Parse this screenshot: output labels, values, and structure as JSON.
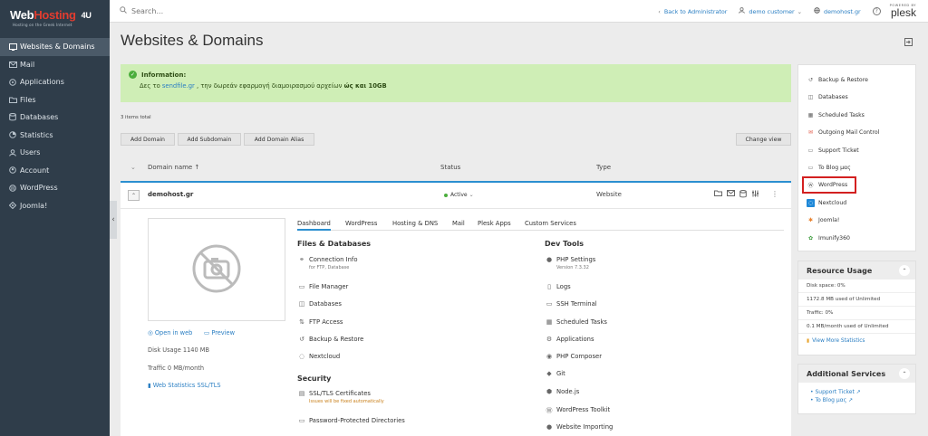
{
  "brand": {
    "name_part1": "Web",
    "name_part2": "Hosting",
    "name_part3": "4U",
    "tagline": "Hosting on the Greek Internet"
  },
  "sidebar": {
    "items": [
      {
        "label": "Websites & Domains",
        "icon": "globe-icon",
        "active": true
      },
      {
        "label": "Mail",
        "icon": "mail-icon"
      },
      {
        "label": "Applications",
        "icon": "applications-icon"
      },
      {
        "label": "Files",
        "icon": "folder-icon"
      },
      {
        "label": "Databases",
        "icon": "database-icon"
      },
      {
        "label": "Statistics",
        "icon": "statistics-icon"
      },
      {
        "label": "Users",
        "icon": "user-icon"
      },
      {
        "label": "Account",
        "icon": "account-icon"
      },
      {
        "label": "WordPress",
        "icon": "wordpress-icon"
      },
      {
        "label": "Joomla!",
        "icon": "joomla-icon"
      }
    ]
  },
  "topbar": {
    "search_placeholder": "Search...",
    "back_to_admin": "Back to Administrator",
    "customer": "demo customer",
    "domain": "demohost.gr",
    "powered_by": "POWERED BY",
    "plesk": "plesk"
  },
  "page": {
    "title": "Websites & Domains"
  },
  "info": {
    "title": "Information:",
    "msg_prefix": "Δες το ",
    "msg_link": "sendfile.gr",
    "msg_middle": " , την δωρεάν εφαρμογή διαμοιρασμού αρχείων ",
    "msg_bold": "ώς και 10GB"
  },
  "list": {
    "items_total": "3 items total",
    "buttons": {
      "add_domain": "Add Domain",
      "add_subdomain": "Add Subdomain",
      "add_alias": "Add Domain Alias",
      "change_view": "Change view"
    },
    "columns": {
      "domain": "Domain name ↑",
      "status": "Status",
      "type": "Type"
    }
  },
  "domain_row": {
    "name": "demohost.gr",
    "status": "Active",
    "type": "Website"
  },
  "domain_panel": {
    "open_in_web": "Open in web",
    "preview": "Preview",
    "disk_usage": "Disk Usage 1140 MB",
    "traffic": "Traffic 0 MB/month",
    "web_stats": "Web Statistics SSL/TLS",
    "tabs": [
      "Dashboard",
      "WordPress",
      "Hosting & DNS",
      "Mail",
      "Plesk Apps",
      "Custom Services"
    ],
    "files_title": "Files & Databases",
    "dev_title": "Dev Tools",
    "security_title": "Security",
    "tools": {
      "connection_info": "Connection Info",
      "connection_info_sub": "for FTP, Database",
      "file_manager": "File Manager",
      "databases": "Databases",
      "ftp_access": "FTP Access",
      "backup_restore": "Backup & Restore",
      "nextcloud": "Nextcloud",
      "ssl_tls": "SSL/TLS Certificates",
      "ssl_tls_sub": "Issues will be fixed automatically",
      "password_dirs": "Password-Protected Directories",
      "php_settings": "PHP Settings",
      "php_version": "Version 7.3.32",
      "logs": "Logs",
      "ssh_terminal": "SSH Terminal",
      "scheduled_tasks": "Scheduled Tasks",
      "applications": "Applications",
      "php_composer": "PHP Composer",
      "git": "Git",
      "nodejs": "Node.js",
      "wp_toolkit": "WordPress Toolkit",
      "website_importing": "Website Importing"
    }
  },
  "right_column": {
    "links": [
      {
        "label": "Backup & Restore",
        "icon": "backup-icon"
      },
      {
        "label": "Databases",
        "icon": "database-icon"
      },
      {
        "label": "Scheduled Tasks",
        "icon": "calendar-icon"
      },
      {
        "label": "Outgoing Mail Control",
        "icon": "mail-control-icon"
      },
      {
        "label": "Support Ticket",
        "icon": "ticket-icon"
      },
      {
        "label": "To Blog μας",
        "icon": "blog-icon"
      },
      {
        "label": "WordPress",
        "icon": "wordpress-icon"
      },
      {
        "label": "Nextcloud",
        "icon": "nextcloud-icon"
      },
      {
        "label": "Joomla!",
        "icon": "joomla-icon"
      },
      {
        "label": "Imunify360",
        "icon": "imunify-icon"
      }
    ],
    "resource_usage": {
      "title": "Resource Usage",
      "disk_label": "Disk space: 0%",
      "disk_value": "1172.8 MB used of Unlimited",
      "traffic_label": "Traffic: 0%",
      "traffic_value": "0.1 MB/month used of Unlimited",
      "view_more": "View More Statistics"
    },
    "additional_services": {
      "title": "Additional Services",
      "support_ticket": "Support Ticket",
      "blog": "To Blog μας"
    }
  },
  "colors": {
    "sidebar_bg": "#2f3d4a",
    "accent_blue": "#2b7fc3",
    "banner_bg": "#cfeeb6",
    "status_green": "#4bae3c",
    "highlight_red": "#d32020"
  }
}
